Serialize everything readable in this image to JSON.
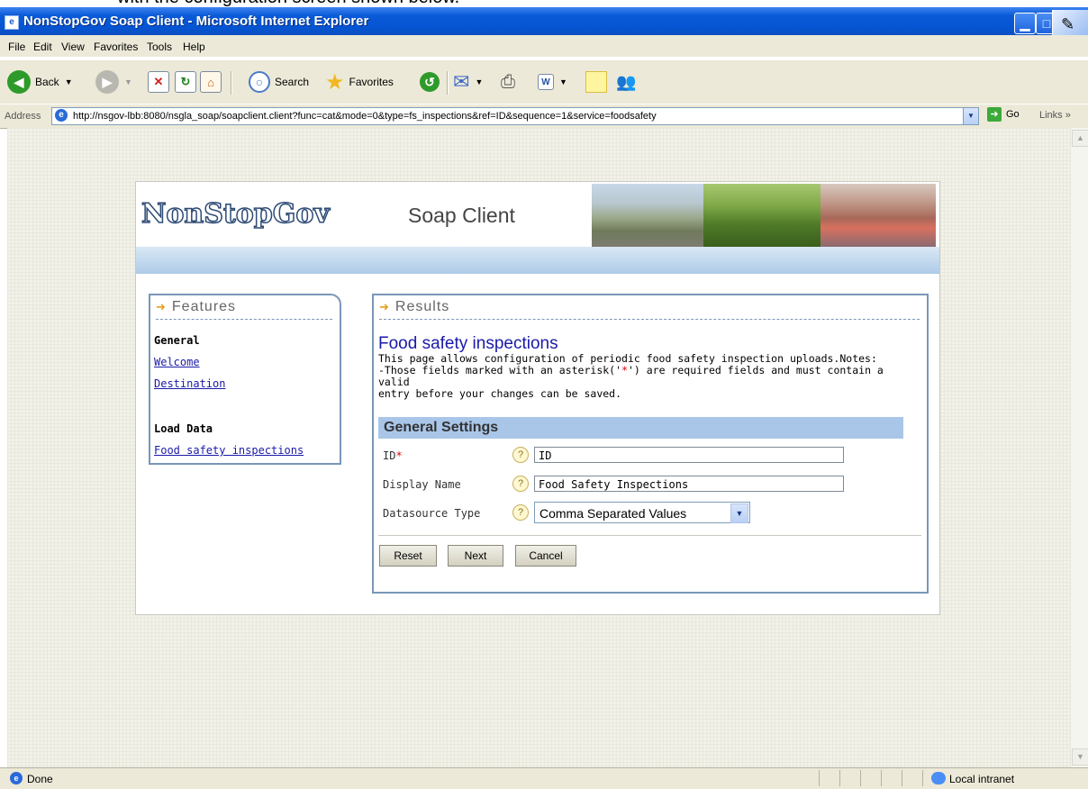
{
  "doc_caption": "with the configuration screen shown below.",
  "window": {
    "title": "NonStopGov Soap Client - Microsoft Internet Explorer",
    "minimize_glyph": "▁",
    "maximize_glyph": "□"
  },
  "menu": [
    "File",
    "Edit",
    "View",
    "Favorites",
    "Tools",
    "Help"
  ],
  "toolbar": {
    "back_label": "Back",
    "search_label": "Search",
    "favorites_label": "Favorites"
  },
  "address": {
    "label": "Address",
    "url": "http://nsgov-lbb:8080/nsgla_soap/soapclient.client?func=cat&mode=0&type=fs_inspections&ref=ID&sequence=1&service=foodsafety",
    "go_label": "Go",
    "links_label": "Links"
  },
  "status": {
    "text": "Done",
    "zone": "Local intranet"
  },
  "header": {
    "logo": "NonStopGov",
    "title": "Soap Client"
  },
  "features": {
    "heading": "Features",
    "general_heading": "General",
    "welcome": "Welcome",
    "destination": "Destination",
    "load_heading": "Load Data",
    "food_safety": "Food safety inspections"
  },
  "results": {
    "heading": "Results",
    "title": "Food safety inspections",
    "desc_line1": "This page allows configuration of periodic food safety inspection uploads.Notes:",
    "desc_line2_pre": "-Those fields marked with an asterisk('",
    "desc_line2_star": "*",
    "desc_line2_post": "') are required fields and must contain a valid",
    "desc_line3": "entry before your changes can be saved."
  },
  "settings": {
    "heading": "General Settings",
    "id_label": "ID",
    "required_star": "*",
    "id_value": "ID",
    "display_name_label": "Display Name",
    "display_name_value": "Food Safety Inspections",
    "datasource_label": "Datasource Type",
    "datasource_value": "Comma Separated Values",
    "help_glyph": "?"
  },
  "buttons": {
    "reset": "Reset",
    "next": "Next",
    "cancel": "Cancel"
  }
}
